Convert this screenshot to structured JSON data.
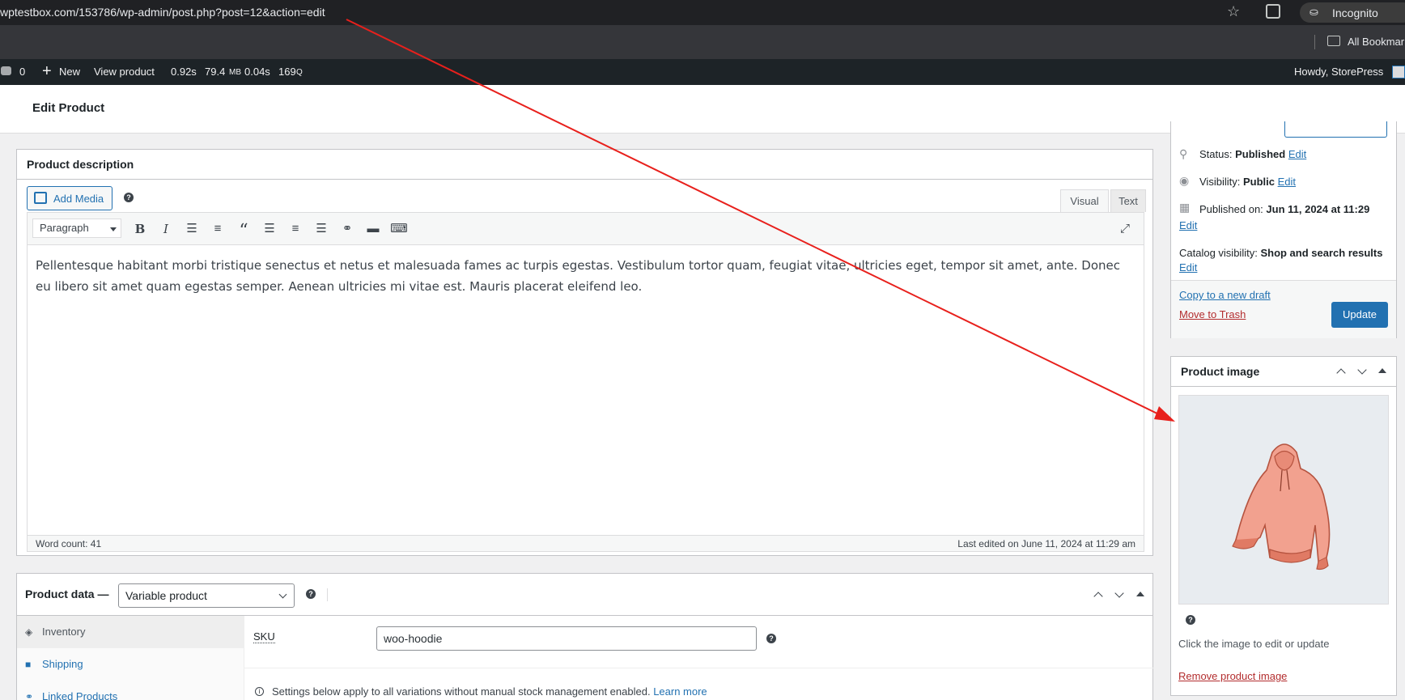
{
  "browser": {
    "url": "wptestbox.com/153786/wp-admin/post.php?post=12&action=edit",
    "incognito_label": "Incognito",
    "bookmarks_label": "All Bookmarks"
  },
  "adminbar": {
    "comments_count": "0",
    "new_label": "New",
    "view_product": "View product",
    "time": "0.92s",
    "memory": "79.4",
    "memory_unit": "MB",
    "db_time": "0.04s",
    "queries": "169",
    "queries_unit": "Q",
    "howdy": "Howdy, StorePress"
  },
  "page": {
    "title": "Edit Product"
  },
  "description": {
    "title": "Product description",
    "add_media": "Add Media",
    "tab_visual": "Visual",
    "tab_text": "Text",
    "format": "Paragraph",
    "content": "Pellentesque habitant morbi tristique senectus et netus et malesuada fames ac turpis egestas. Vestibulum tortor quam, feugiat vitae, ultricies eget, tempor sit amet, ante. Donec eu libero sit amet quam egestas semper. Aenean ultricies mi vitae est. Mauris placerat eleifend leo.",
    "word_count": "Word count: 41",
    "last_edited": "Last edited on June 11, 2024 at 11:29 am"
  },
  "product_data": {
    "title": "Product data —",
    "type": "Variable product",
    "tabs": [
      {
        "label": "Inventory"
      },
      {
        "label": "Shipping"
      },
      {
        "label": "Linked Products"
      }
    ],
    "sku_label": "SKU",
    "sku_value": "woo-hoodie",
    "notice": "Settings below apply to all variations without manual stock management enabled.",
    "learn_more": "Learn more"
  },
  "publish": {
    "status_label": "Status:",
    "status_value": "Published",
    "visibility_label": "Visibility:",
    "visibility_value": "Public",
    "published_label": "Published on:",
    "published_value": "Jun 11, 2024 at 11:29",
    "catalog_label": "Catalog visibility:",
    "catalog_value": "Shop and search results",
    "edit": "Edit",
    "copy_draft": "Copy to a new draft",
    "trash": "Move to Trash",
    "update": "Update"
  },
  "product_image": {
    "title": "Product image",
    "caption": "Click the image to edit or update",
    "remove": "Remove product image"
  },
  "colors": {
    "wp_blue": "#2271b1",
    "danger": "#b32d2e",
    "annotation": "#e8201c",
    "hoodie": "#f2a18f"
  }
}
